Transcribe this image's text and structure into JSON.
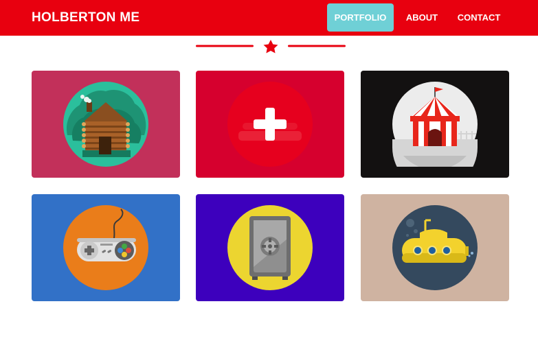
{
  "brand": "HOLBERTON ME",
  "nav": {
    "portfolio": "PORTFOLIO",
    "about": "ABOUT",
    "contact": "CONTACT",
    "active": "PORTFOLIO"
  },
  "colors": {
    "navbar": "#e8000f",
    "active_nav": "#6fd0d6",
    "accent": "#e8000f"
  },
  "divider_icon": "star-icon",
  "portfolio": [
    {
      "icon": "log-cabin-icon",
      "bg": "#c2305a"
    },
    {
      "icon": "plus-icon",
      "bg": "#d6002e"
    },
    {
      "icon": "circus-tent-icon",
      "bg": "#131111"
    },
    {
      "icon": "game-controller-icon",
      "bg": "#3271c7"
    },
    {
      "icon": "safe-icon",
      "bg": "#3d00bd"
    },
    {
      "icon": "submarine-icon",
      "bg": "#cfb3a1"
    }
  ]
}
